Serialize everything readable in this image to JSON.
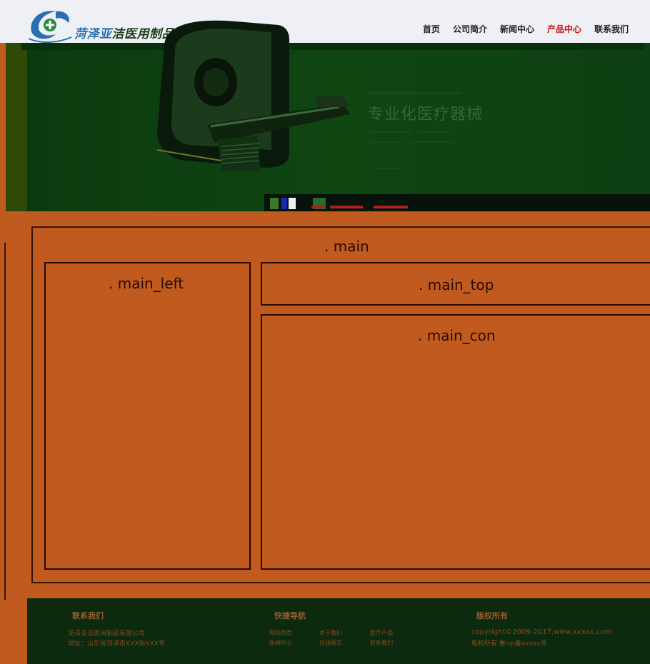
{
  "header": {
    "logo_text_blue": "菏泽亚",
    "logo_text_dark": "洁医用制品有限公司",
    "nav": [
      {
        "label": "首页",
        "active": false
      },
      {
        "label": "公司简介",
        "active": false
      },
      {
        "label": "新闻中心",
        "active": false
      },
      {
        "label": "产品中心",
        "active": true
      },
      {
        "label": "联系我们",
        "active": false
      }
    ]
  },
  "banner": {
    "title": "专业化医疗器械"
  },
  "main": {
    "label": ". main",
    "left_label": ". main_left",
    "top_label": ". main_top",
    "con_label": ". main_con"
  },
  "footer": {
    "contact_heading": "联系我们",
    "contact_company": "菏泽亚洁医用制品有限公司",
    "contact_address": "地址：山东省菏泽市XXX街XXX号",
    "nav_heading": "快捷导航",
    "nav_links": [
      "网站首页",
      "关于我们",
      "医疗产品",
      "新闻中心",
      "在线留言",
      "联系我们"
    ],
    "copyright_heading": "版权所有",
    "copyright_line1": "copyright©2009-2017,www.xxxxx.com",
    "copyright_line2": "版权所有 鲁icp备xxxxx号"
  },
  "colors": {
    "page_bg": "#c05a1e",
    "banner_bg": "#0d3f10",
    "footer_bg": "#0b2a10",
    "nav_active": "#d01010",
    "logo_blue": "#2a6fb0"
  }
}
